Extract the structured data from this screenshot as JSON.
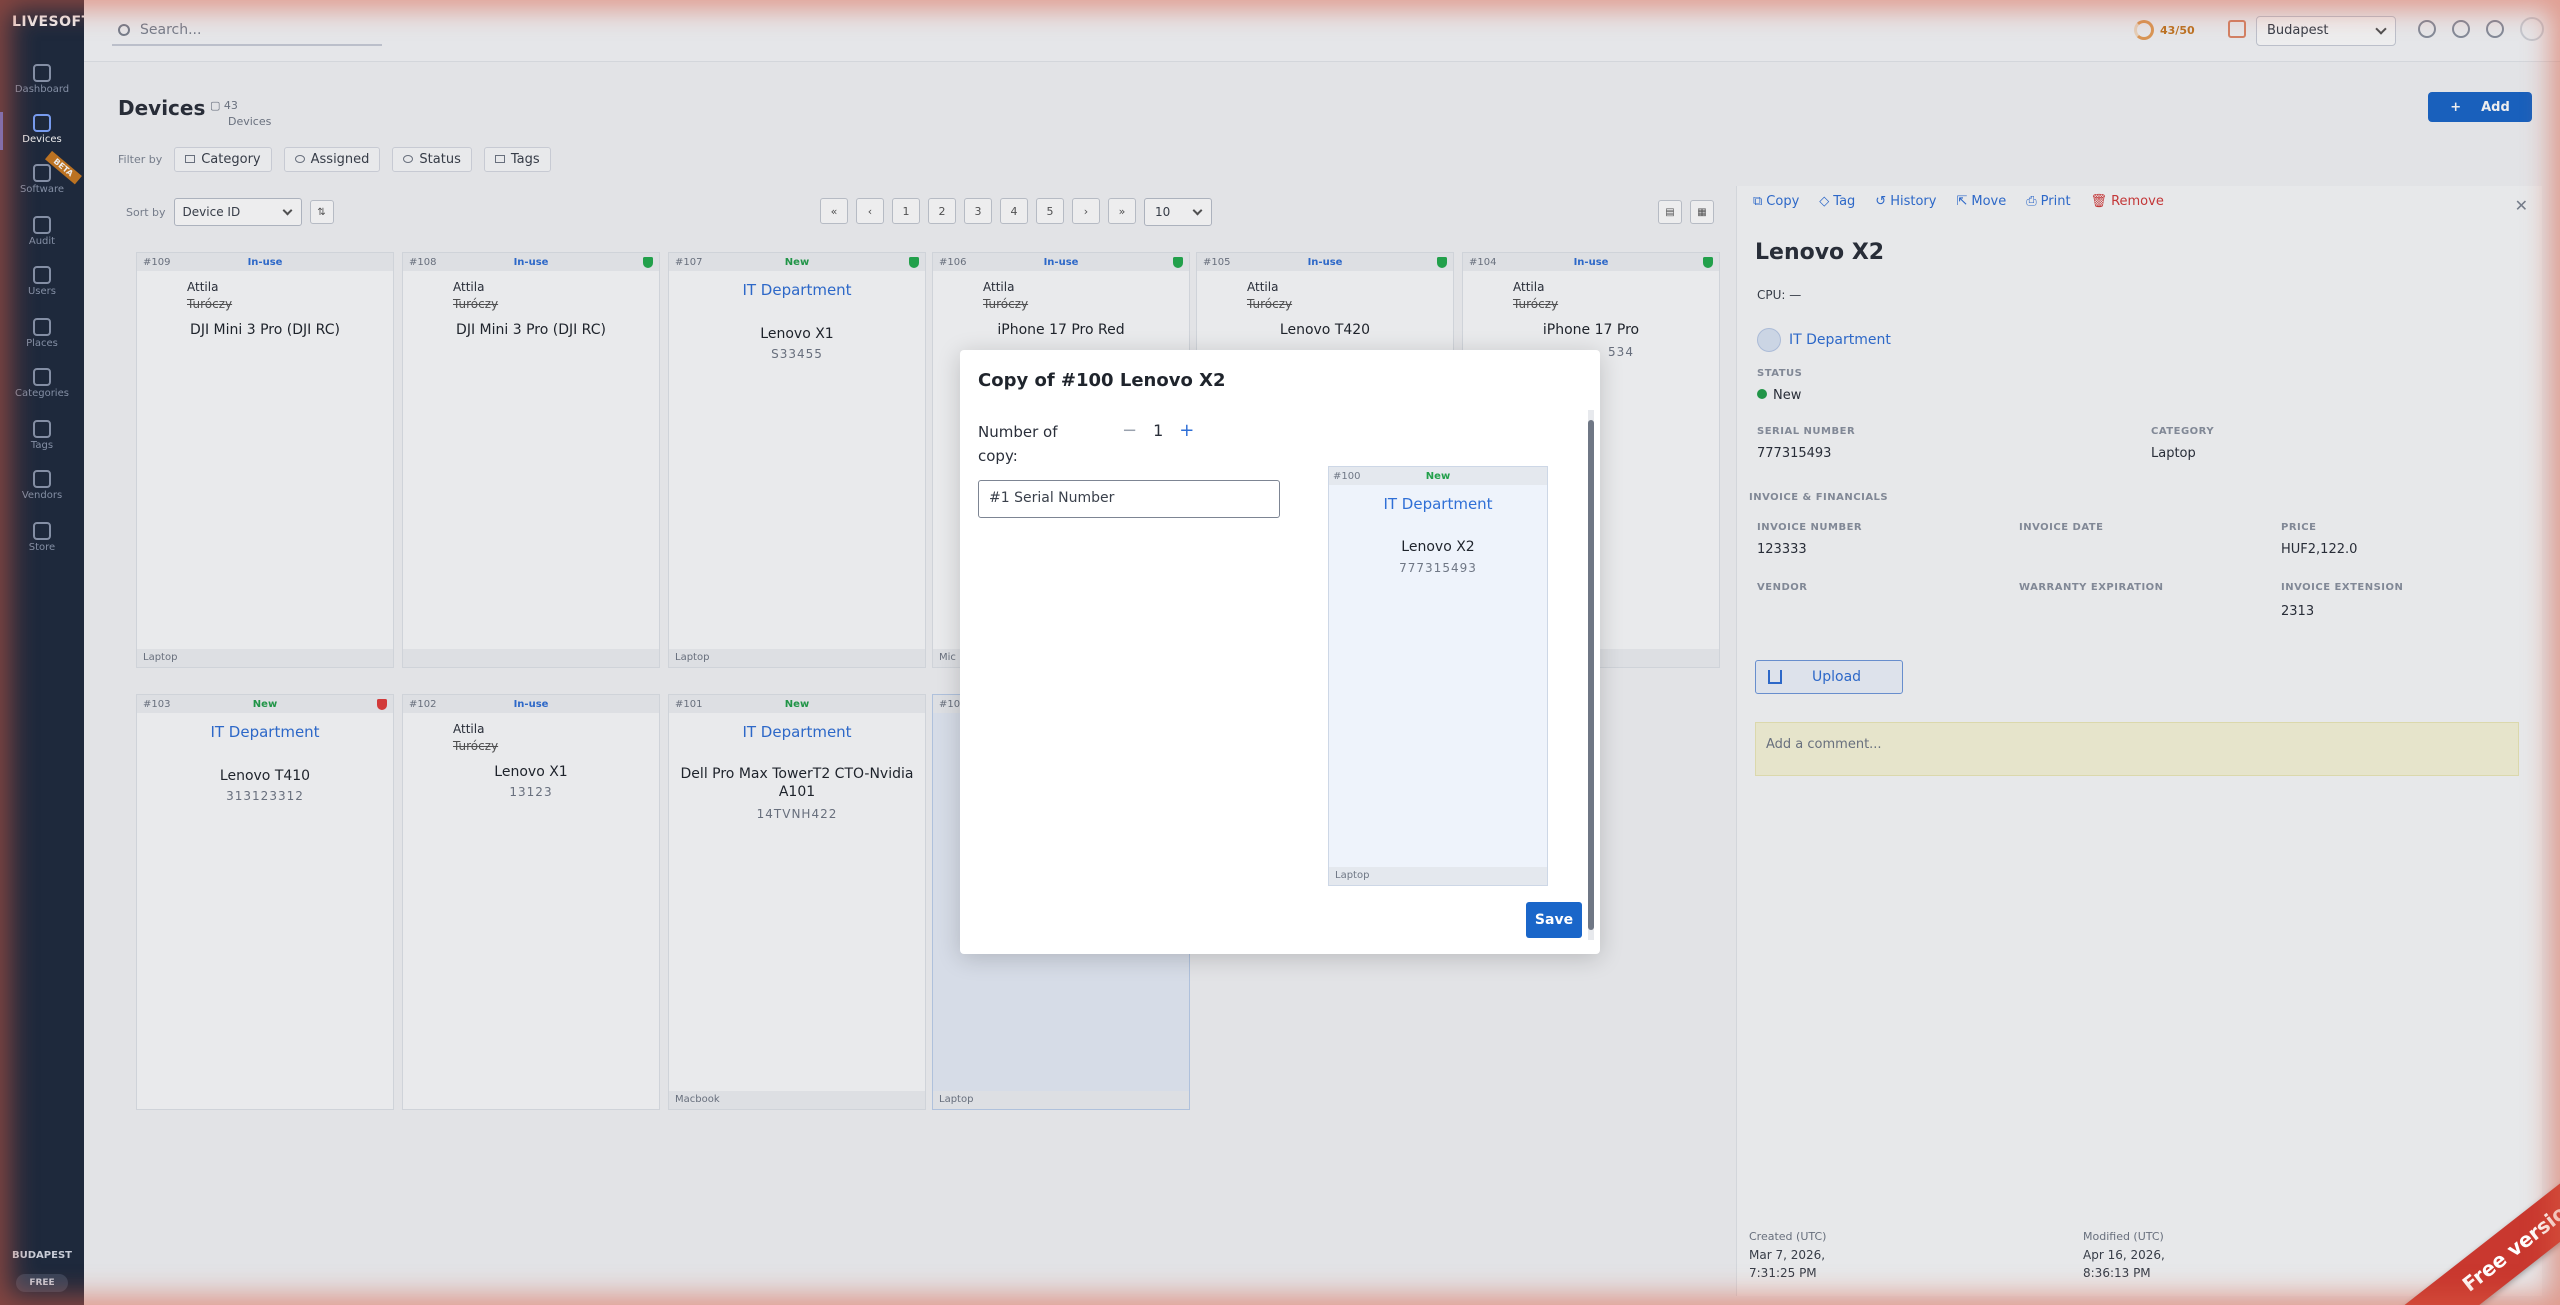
{
  "app": {
    "brand": "LIVESOFT"
  },
  "sidebar": {
    "items": [
      {
        "label": "Dashboard",
        "icon": "dashboard-icon"
      },
      {
        "label": "Devices",
        "icon": "devices-icon",
        "active": true
      },
      {
        "label": "Software",
        "icon": "software-icon",
        "badge": "BETA"
      },
      {
        "label": "Audit",
        "icon": "audit-icon"
      },
      {
        "label": "Users",
        "icon": "users-icon"
      },
      {
        "label": "Places",
        "icon": "places-icon"
      },
      {
        "label": "Categories",
        "icon": "categories-icon"
      },
      {
        "label": "Tags",
        "icon": "tags-icon"
      },
      {
        "label": "Vendors",
        "icon": "vendors-icon"
      },
      {
        "label": "Store",
        "icon": "store-icon"
      }
    ],
    "location": "BUDAPEST",
    "plan": "FREE"
  },
  "topbar": {
    "search_placeholder": "Search...",
    "quota": "43/50",
    "location_select": "Budapest"
  },
  "page": {
    "title": "Devices",
    "count": "43",
    "count_label": "Devices",
    "add_label": "Add"
  },
  "filters": {
    "label": "Filter by",
    "chips": [
      "Category",
      "Assigned",
      "Status",
      "Tags"
    ]
  },
  "sorting": {
    "label": "Sort by",
    "field": "Device ID",
    "pages": [
      "1",
      "2",
      "3",
      "4",
      "5"
    ],
    "per_page": "10"
  },
  "cards": [
    {
      "id": "#109",
      "status": "In-use",
      "owner_first": "Attila",
      "owner_last": "Turóczy",
      "name": "DJI Mini 3 Pro (DJI RC)",
      "serial": "",
      "category": "Laptop"
    },
    {
      "id": "#108",
      "status": "In-use",
      "owner_first": "Attila",
      "owner_last": "Turóczy",
      "name": "DJI Mini 3 Pro (DJI RC)",
      "serial": "",
      "category": ""
    },
    {
      "id": "#107",
      "status": "New",
      "dept": "IT Department",
      "name": "Lenovo X1",
      "serial": "S33455",
      "category": "Laptop"
    },
    {
      "id": "#106",
      "status": "In-use",
      "owner_first": "Attila",
      "owner_last": "Turóczy",
      "name": "iPhone 17 Pro Red",
      "serial": "",
      "category": "Mic"
    },
    {
      "id": "#105",
      "status": "In-use",
      "owner_first": "Attila",
      "owner_last": "Turóczy",
      "name": "Lenovo T420",
      "serial": "",
      "category": ""
    },
    {
      "id": "#104",
      "status": "In-use",
      "owner_first": "Attila",
      "owner_last": "Turóczy",
      "name": "iPhone 17 Pro",
      "serial": "534",
      "category": ""
    },
    {
      "id": "#103",
      "status": "New",
      "dept": "IT Department",
      "name": "Lenovo T410",
      "serial": "313123312",
      "category": ""
    },
    {
      "id": "#102",
      "status": "In-use",
      "owner_first": "Attila",
      "owner_last": "Turóczy",
      "name": "Lenovo X1",
      "serial": "13123",
      "category": ""
    },
    {
      "id": "#101",
      "status": "New",
      "dept": "IT Department",
      "name": "Dell Pro Max TowerT2 CTO-Nvidia A101",
      "serial": "14TVNH422",
      "category": "Macbook"
    },
    {
      "id": "#100",
      "status": "",
      "name": "",
      "serial": "",
      "category": "Laptop"
    }
  ],
  "detail": {
    "actions": [
      "Copy",
      "Tag",
      "History",
      "Move",
      "Print",
      "Remove"
    ],
    "title": "Lenovo X2",
    "cpu": "CPU: —",
    "dept": "IT Department",
    "status_label": "STATUS",
    "status": "New",
    "serial_label": "SERIAL NUMBER",
    "serial": "777315493",
    "category_label": "CATEGORY",
    "category": "Laptop",
    "invoice_section": "INVOICE & FINANCIALS",
    "invoice_number_label": "INVOICE NUMBER",
    "invoice_number": "123333",
    "invoice_date_label": "INVOICE DATE",
    "price_label": "PRICE",
    "price": "HUF2,122.0",
    "vendor_label": "VENDOR",
    "warranty_label": "WARRANTY EXPIRATION",
    "extension_label": "INVOICE EXTENSION",
    "extension": "2313",
    "upload_label": "Upload",
    "comment_placeholder": "Add a comment...",
    "created_label": "Created (UTC)",
    "created_date": "Mar 7, 2026,",
    "created_time": "7:31:25 PM",
    "modified_label": "Modified (UTC)",
    "modified_date": "Apr 16, 2026,",
    "modified_time": "8:36:13 PM"
  },
  "modal": {
    "title": "Copy of #100 Lenovo X2",
    "qty_label_1": "Number of",
    "qty_label_2": "copy:",
    "qty_value": "1",
    "minus": "−",
    "plus": "+",
    "input_value": "#1 Serial Number",
    "preview": {
      "id": "#100",
      "status": "New",
      "dept": "IT Department",
      "name": "Lenovo X2",
      "serial": "777315493",
      "category": "Laptop"
    },
    "save_label": "Save"
  },
  "ribbon": "Free version"
}
